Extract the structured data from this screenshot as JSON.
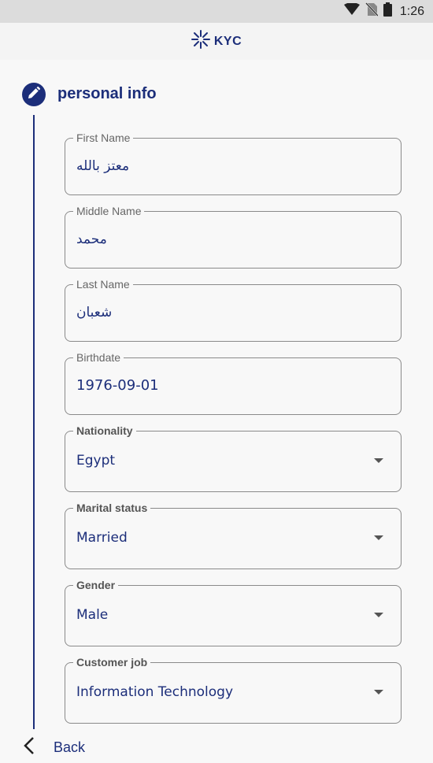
{
  "status_bar": {
    "time": "1:26"
  },
  "header": {
    "logo_text": "KYC"
  },
  "step": {
    "title": "personal info"
  },
  "fields": [
    {
      "label": "First Name",
      "value": "معتز بالله",
      "type": "text"
    },
    {
      "label": "Middle Name",
      "value": "محمد",
      "type": "text"
    },
    {
      "label": "Last Name",
      "value": "شعبان",
      "type": "text"
    },
    {
      "label": "Birthdate",
      "value": "1976-09-01",
      "type": "date"
    },
    {
      "label": "Nationality",
      "value": "Egypt",
      "type": "select"
    },
    {
      "label": "Marital status",
      "value": "Married",
      "type": "select"
    },
    {
      "label": "Gender",
      "value": "Male",
      "type": "select"
    },
    {
      "label": "Customer job",
      "value": "Information Technology",
      "type": "select"
    }
  ],
  "footer": {
    "back_label": "Back"
  },
  "colors": {
    "primary": "#1c2e7a",
    "border": "#8a8a8a",
    "status_bar": "#dcdcdc"
  }
}
